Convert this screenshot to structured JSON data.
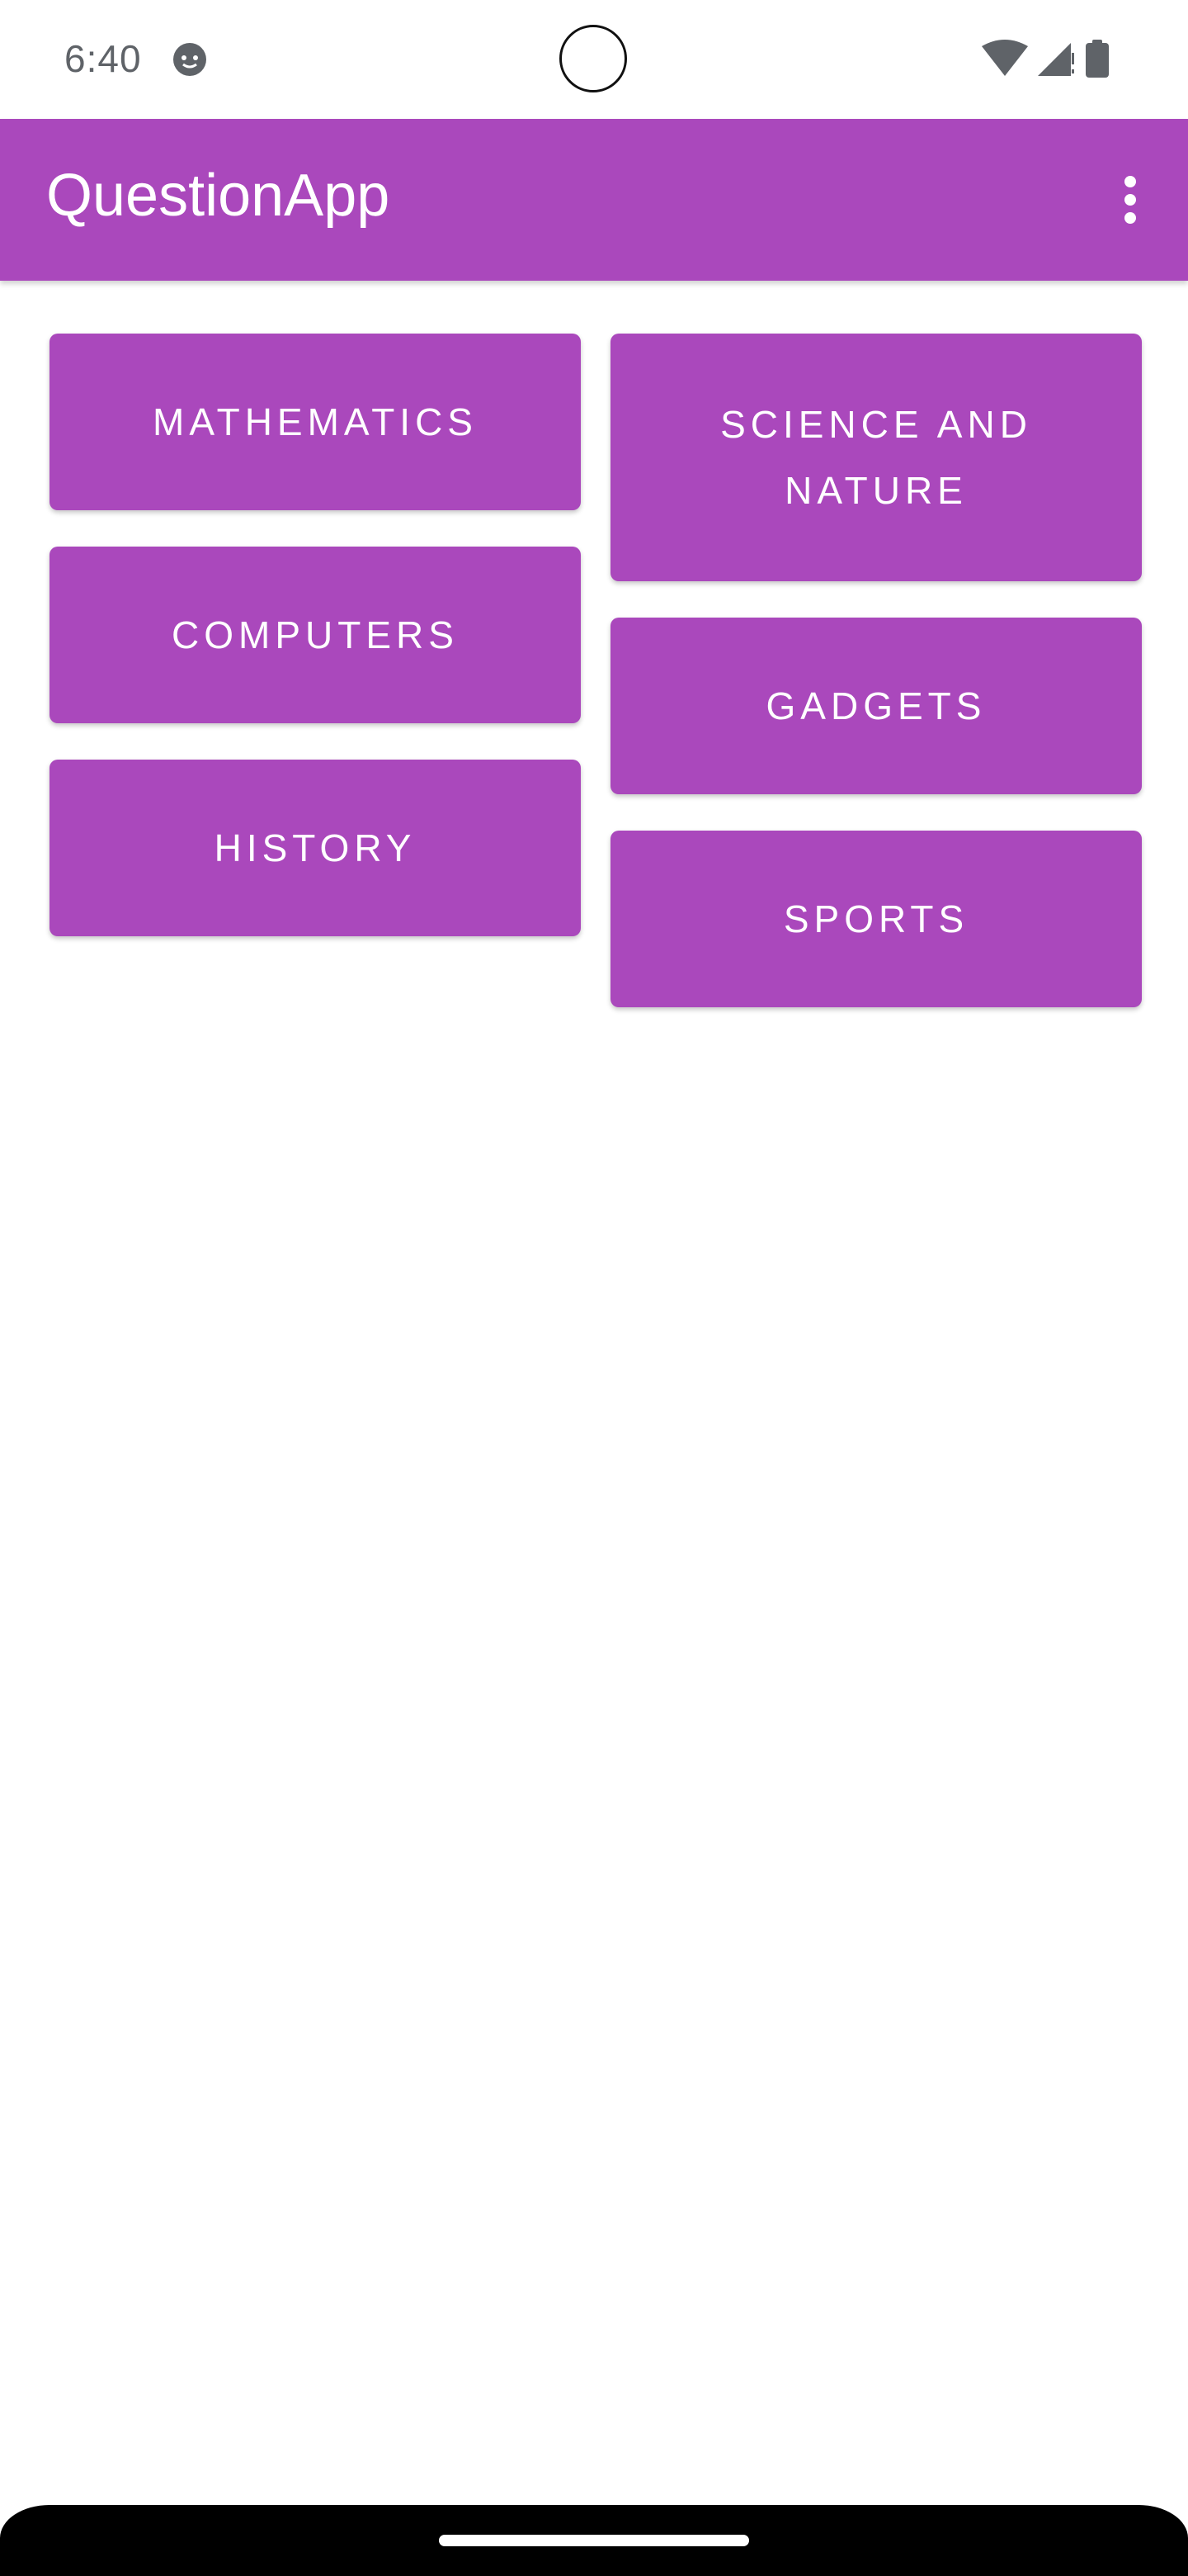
{
  "status_bar": {
    "time": "6:40",
    "icons": [
      "cat-face-icon",
      "wifi-icon",
      "signal-icon",
      "battery-icon"
    ]
  },
  "app_bar": {
    "title": "QuestionApp",
    "menu_icon": "more-vert-icon",
    "color": "#aa48bc"
  },
  "categories": {
    "left": [
      "MATHEMATICS",
      "COMPUTERS",
      "HISTORY"
    ],
    "right": [
      "SCIENCE AND NATURE",
      "GADGETS",
      "SPORTS"
    ]
  },
  "colors": {
    "accent": "#aa48bc",
    "background": "#ffffff",
    "text_on_accent": "#ffffff"
  }
}
